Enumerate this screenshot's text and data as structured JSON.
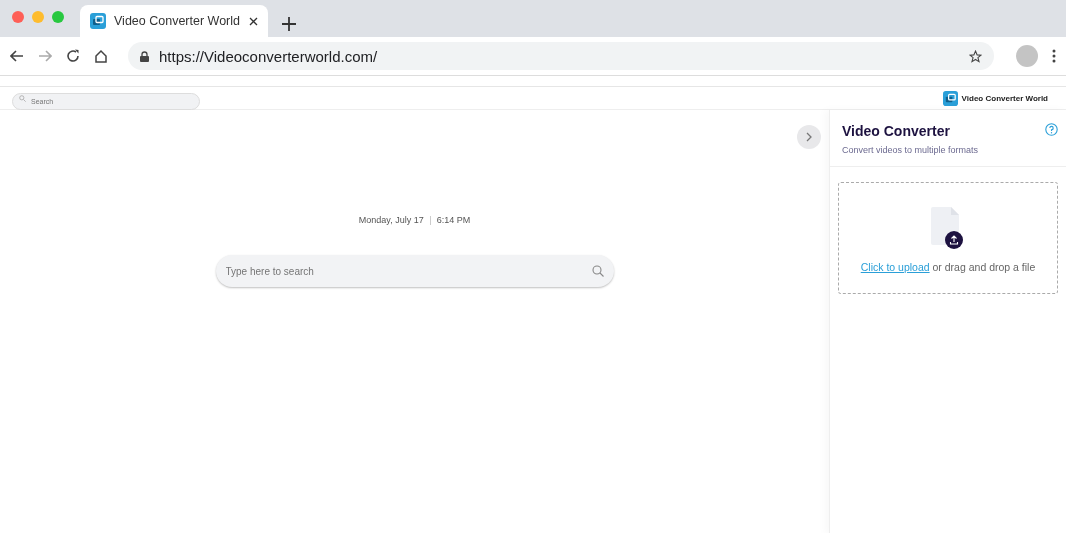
{
  "browser": {
    "tab": {
      "title": "Video Converter World"
    },
    "url": "https://Videoconverterworld.com/"
  },
  "page": {
    "top_search": {
      "placeholder": "Search"
    },
    "brand": "Video Converter World",
    "date": "Monday, July 17",
    "time": "6:14 PM",
    "search": {
      "placeholder": "Type here to search"
    }
  },
  "panel": {
    "title": "Video Converter",
    "subtitle": "Convert videos to multiple formats",
    "upload": {
      "link": "Click to upload",
      "text": "or drag and drop a file"
    }
  }
}
